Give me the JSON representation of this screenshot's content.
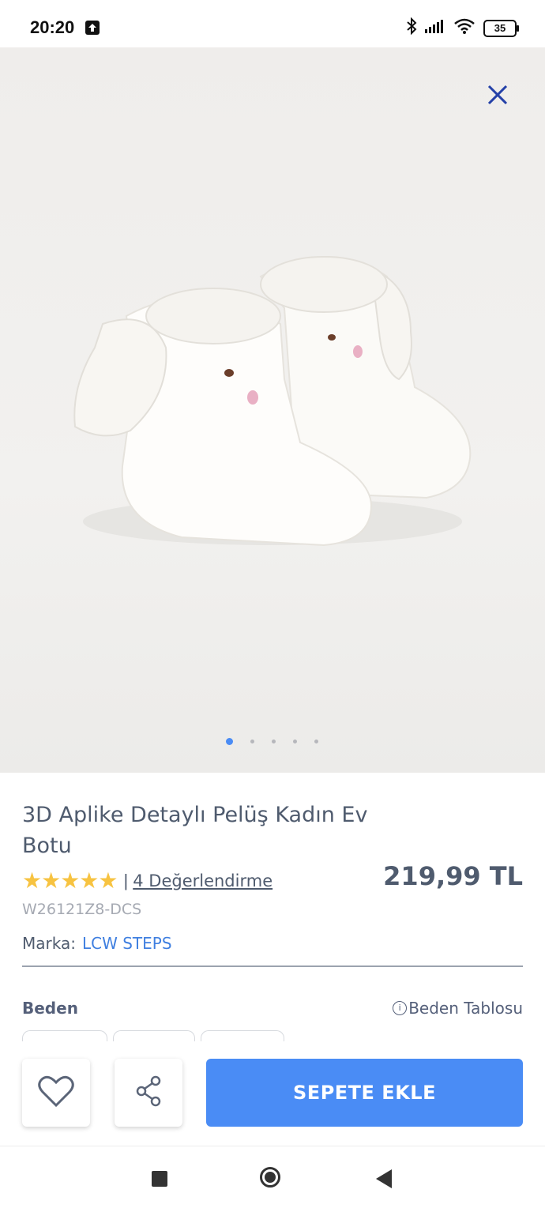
{
  "status_bar": {
    "time": "20:20",
    "battery": "35"
  },
  "gallery": {
    "image_count": 5,
    "active_index": 0
  },
  "product": {
    "title": "3D Aplike Detaylı Pelüş Kadın Ev Botu",
    "stars": "★★★★★",
    "rating": 5,
    "separator": "|",
    "reviews": "4 Değerlendirme",
    "price": "219,99 TL",
    "sku": "W26121Z8-DCS",
    "brand_label": "Marka:",
    "brand_name": "LCW STEPS"
  },
  "size": {
    "label": "Beden",
    "table_link": "Beden Tablosu"
  },
  "actions": {
    "add_to_cart": "SEPETE EKLE"
  },
  "colors": {
    "accent": "#4a8cf5",
    "star": "#f7c341",
    "brand_link": "#3f7fe0",
    "close_icon": "#2541a8"
  }
}
